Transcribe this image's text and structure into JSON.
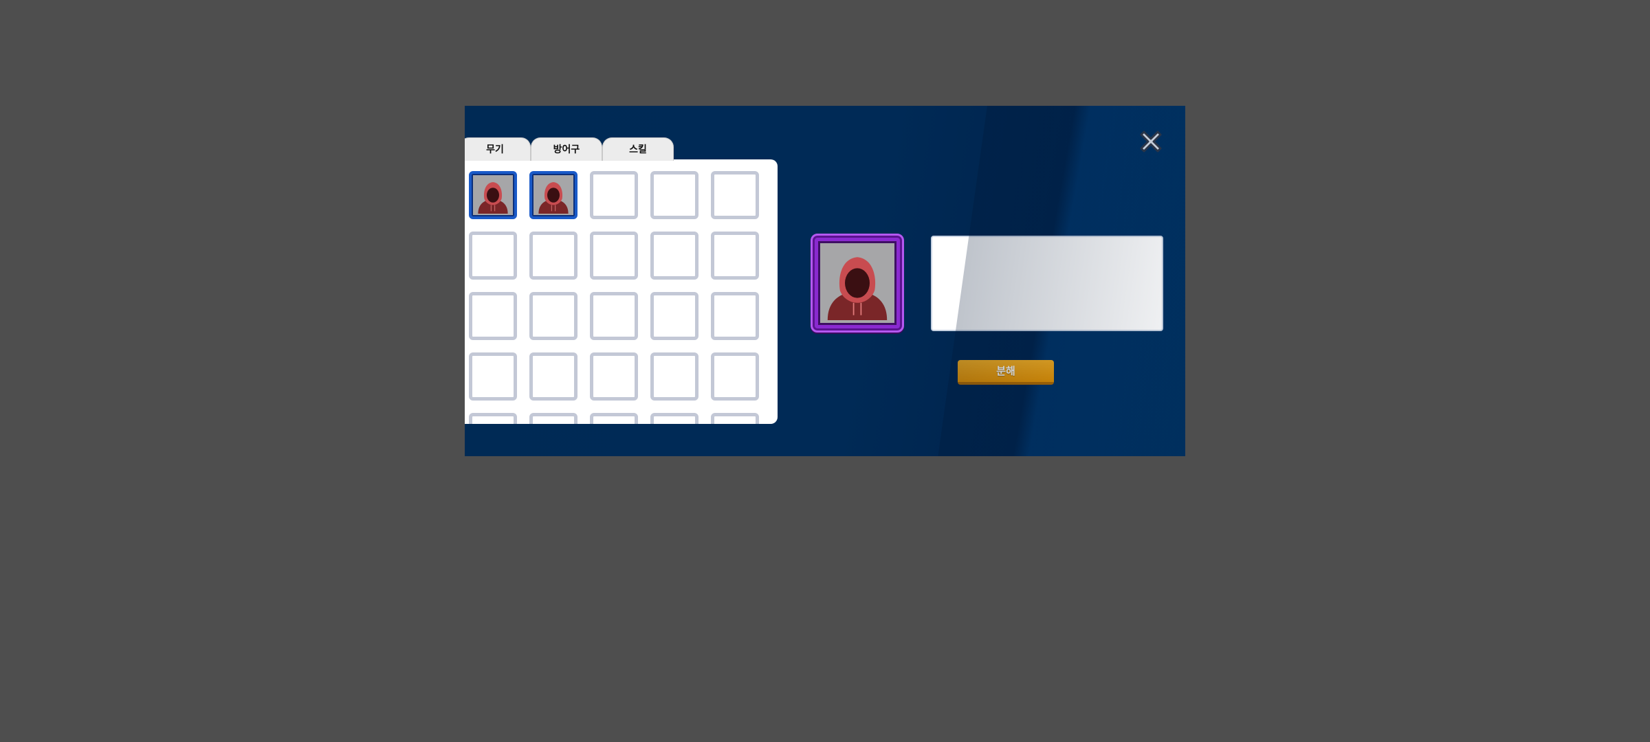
{
  "tabs": [
    {
      "label": "무기"
    },
    {
      "label": "방어구"
    },
    {
      "label": "스킬"
    }
  ],
  "inventory": {
    "columns": 5,
    "slots": [
      {
        "filled": true,
        "icon": "hooded-figure-icon"
      },
      {
        "filled": true,
        "icon": "hooded-figure-icon"
      },
      {
        "filled": false
      },
      {
        "filled": false
      },
      {
        "filled": false
      },
      {
        "filled": false
      },
      {
        "filled": false
      },
      {
        "filled": false
      },
      {
        "filled": false
      },
      {
        "filled": false
      },
      {
        "filled": false
      },
      {
        "filled": false
      },
      {
        "filled": false
      },
      {
        "filled": false
      },
      {
        "filled": false
      },
      {
        "filled": false
      },
      {
        "filled": false
      },
      {
        "filled": false
      },
      {
        "filled": false
      },
      {
        "filled": false
      },
      {
        "filled": false
      },
      {
        "filled": false
      },
      {
        "filled": false
      },
      {
        "filled": false
      },
      {
        "filled": false
      }
    ]
  },
  "preview": {
    "icon": "hooded-figure-icon",
    "frame_color": "#8a2ad0"
  },
  "info": {
    "text": ""
  },
  "decompose_button": {
    "label": "분해"
  },
  "close": {
    "icon": "close-icon"
  },
  "colors": {
    "panel_bg": "#002a56",
    "slot_border": "#c3c8d6",
    "selected_slot_border": "#1a5ac8",
    "button_accent": "#f0a010"
  }
}
